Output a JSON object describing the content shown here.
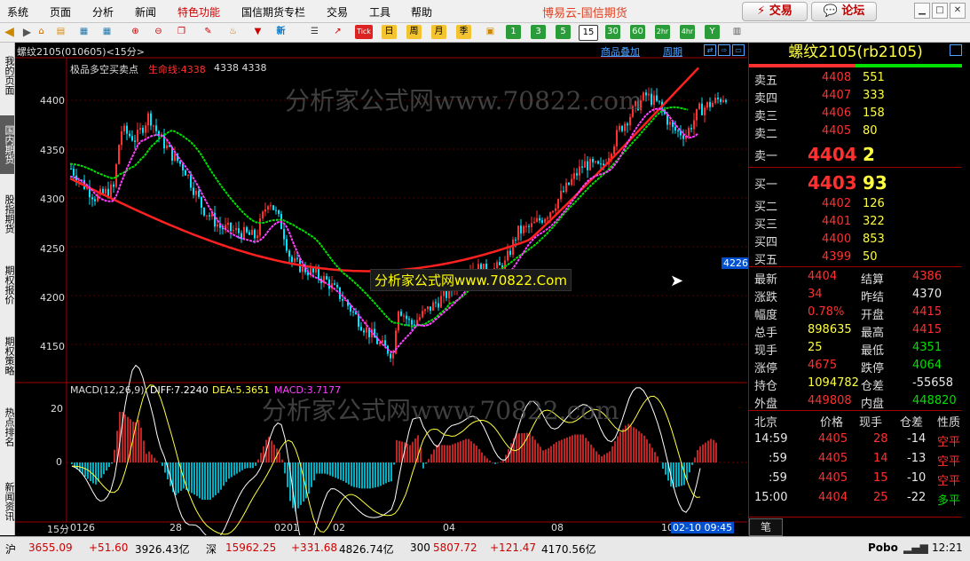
{
  "menu": [
    "系统",
    "页面",
    "分析",
    "新闻",
    "特色功能",
    "国信期货专栏",
    "交易",
    "工具",
    "帮助"
  ],
  "brand": "博易云-国信期货",
  "trade_button": "交易",
  "forum_button": "论坛",
  "toolbar": {
    "period_buttons": [
      "日",
      "周",
      "月",
      "季"
    ],
    "minute_buttons": [
      "1",
      "3",
      "5",
      "15",
      "30",
      "60",
      "2hr",
      "4hr",
      "Y"
    ],
    "new_label": "新",
    "tick_label": "Tick"
  },
  "left_tabs": [
    "我的页面",
    "国内期货",
    "股指期货",
    "期权报价",
    "期权策略",
    "热点排名",
    "新闻资讯"
  ],
  "chart": {
    "symbol_header": "螺纹2105(010605)<15分>",
    "link_overlay": "商品叠加",
    "link_period": "周期",
    "indicator_title": "极品多空买卖点",
    "lifeline_label": "生命线:4338",
    "lifeline_extra": "4338 4338",
    "price_ticks": [
      "4400",
      "4350",
      "4300",
      "4250",
      "4200",
      "4150"
    ],
    "price_marker": "4226",
    "macd_label": "MACD(12,26,9)",
    "macd_diff": "DIFF:7.2240",
    "macd_dea": "DEA:5.3651",
    "macd_val": "MACD:3.7177",
    "macd_ticks": [
      "20",
      "0"
    ],
    "x_ticks": [
      "0126",
      "28",
      "0201",
      "02",
      "04",
      "08",
      "10"
    ],
    "x_period": "15分",
    "cursor_time": "02-10 09:45",
    "watermark_cn": "分析家公式网www.70822.com",
    "watermark_box": "分析家公式网www.70822.Com"
  },
  "quote": {
    "title": "螺纹2105(rb2105)",
    "asks": [
      {
        "label": "卖五",
        "price": "4408",
        "vol": "551"
      },
      {
        "label": "卖四",
        "price": "4407",
        "vol": "333"
      },
      {
        "label": "卖三",
        "price": "4406",
        "vol": "158"
      },
      {
        "label": "卖二",
        "price": "4405",
        "vol": "80"
      },
      {
        "label": "卖一",
        "price": "4404",
        "vol": "2"
      }
    ],
    "bids": [
      {
        "label": "买一",
        "price": "4403",
        "vol": "93"
      },
      {
        "label": "买二",
        "price": "4402",
        "vol": "126"
      },
      {
        "label": "买三",
        "price": "4401",
        "vol": "322"
      },
      {
        "label": "买四",
        "price": "4400",
        "vol": "853"
      },
      {
        "label": "买五",
        "price": "4399",
        "vol": "50"
      }
    ],
    "stats": [
      {
        "l1": "最新",
        "v1": "4404",
        "c1": "red",
        "l2": "结算",
        "v2": "4386",
        "c2": "red"
      },
      {
        "l1": "涨跌",
        "v1": "34",
        "c1": "red",
        "l2": "昨结",
        "v2": "4370",
        "c2": "wht"
      },
      {
        "l1": "幅度",
        "v1": "0.78%",
        "c1": "red",
        "l2": "开盘",
        "v2": "4415",
        "c2": "red"
      },
      {
        "l1": "总手",
        "v1": "898635",
        "c1": "yel",
        "l2": "最高",
        "v2": "4415",
        "c2": "red"
      },
      {
        "l1": "现手",
        "v1": "25",
        "c1": "yel",
        "l2": "最低",
        "v2": "4351",
        "c2": "grn"
      },
      {
        "l1": "涨停",
        "v1": "4675",
        "c1": "red",
        "l2": "跌停",
        "v2": "4064",
        "c2": "grn"
      },
      {
        "l1": "持仓",
        "v1": "1094782",
        "c1": "yel",
        "l2": "仓差",
        "v2": "-55658",
        "c2": "wht"
      },
      {
        "l1": "外盘",
        "v1": "449808",
        "c1": "red",
        "l2": "内盘",
        "v2": "448820",
        "c2": "grn"
      }
    ],
    "tick_header": [
      "北京",
      "价格",
      "现手",
      "仓差",
      "性质"
    ],
    "ticks": [
      {
        "time": "14:59",
        "price": "4405",
        "vol": "28",
        "diff": "-14",
        "nature": "空平",
        "nc": "red"
      },
      {
        "time": ":59",
        "price": "4405",
        "vol": "14",
        "diff": "-13",
        "nature": "空平",
        "nc": "red"
      },
      {
        "time": ":59",
        "price": "4405",
        "vol": "15",
        "diff": "-10",
        "nature": "空平",
        "nc": "red"
      },
      {
        "time": "15:00",
        "price": "4404",
        "vol": "25",
        "diff": "-22",
        "nature": "多平",
        "nc": "grn"
      }
    ],
    "tab_label": "笔"
  },
  "status": {
    "sh_label": "沪",
    "sh_val": "3655.09",
    "sh_chg": "+51.60",
    "sh_amt": "3926.43亿",
    "sz_label": "深",
    "sz_val": "15962.25",
    "sz_chg": "+331.68",
    "sz_amt": "4826.74亿",
    "i300_label": "300",
    "i300_val": "5807.72",
    "i300_chg": "+121.47",
    "i300_amt": "4170.56亿",
    "app": "Pobo",
    "time": "12:21"
  },
  "colors": {
    "up": "#ff3030",
    "down": "#00e5ff",
    "ma_green": "#00e000",
    "ma_magenta": "#ff40ff",
    "lifeline": "#ff2020"
  }
}
